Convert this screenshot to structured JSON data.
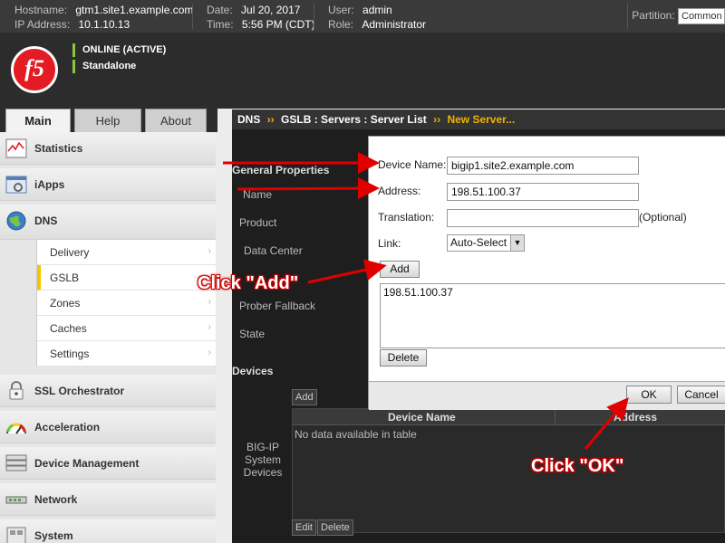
{
  "topbar": {
    "hostname_label": "Hostname:",
    "hostname": "gtm1.site1.example.com",
    "ip_label": "IP Address:",
    "ip": "10.1.10.13",
    "date_label": "Date:",
    "date": "Jul 20, 2017",
    "time_label": "Time:",
    "time": "5:56 PM (CDT)",
    "user_label": "User:",
    "user": "admin",
    "role_label": "Role:",
    "role": "Administrator",
    "partition_label": "Partition:",
    "partition": "Common"
  },
  "header": {
    "logo_text": "f5",
    "status_online": "ONLINE (ACTIVE)",
    "status_mode": "Standalone"
  },
  "tabs": [
    {
      "label": "Main",
      "active": true
    },
    {
      "label": "Help",
      "active": false
    },
    {
      "label": "About",
      "active": false
    }
  ],
  "sidebar": {
    "items": [
      {
        "label": "Statistics",
        "icon": "statistics-icon"
      },
      {
        "label": "iApps",
        "icon": "iapps-icon"
      },
      {
        "label": "DNS",
        "icon": "globe-icon"
      },
      {
        "label": "SSL Orchestrator",
        "icon": "lock-icon"
      },
      {
        "label": "Acceleration",
        "icon": "speedometer-icon"
      },
      {
        "label": "Device Management",
        "icon": "server-icon"
      },
      {
        "label": "Network",
        "icon": "network-icon"
      },
      {
        "label": "System",
        "icon": "system-icon"
      }
    ],
    "dns_sub": [
      {
        "label": "Delivery",
        "chevron": "›"
      },
      {
        "label": "GSLB",
        "chevron": ""
      },
      {
        "label": "Zones",
        "chevron": "›"
      },
      {
        "label": "Caches",
        "chevron": "›"
      },
      {
        "label": "Settings",
        "chevron": "›"
      }
    ]
  },
  "breadcrumb": {
    "parts": [
      "DNS",
      "GSLB : Servers : Server List"
    ],
    "current": "New Server...",
    "sep": "››"
  },
  "background_form": {
    "general_properties": "General Properties",
    "rows": [
      "Name",
      "Product",
      "Data Center",
      "Prober Fallback",
      "State"
    ],
    "devices_heading": "Devices",
    "bigip_label": "BIG-IP System Devices",
    "add_label": "Add",
    "col_device_name": "Device Name",
    "col_address": "Address",
    "no_data": "No data available in table",
    "edit_label": "Edit",
    "delete_label": "Delete"
  },
  "dialog": {
    "device_name_label": "Device Name:",
    "device_name": "bigip1.site2.example.com",
    "address_label": "Address:",
    "address": "198.51.100.37",
    "translation_label": "Translation:",
    "translation": "",
    "optional": "(Optional)",
    "link_label": "Link:",
    "link_value": "Auto-Select",
    "add_button": "Add",
    "address_list": [
      "198.51.100.37"
    ],
    "delete_button": "Delete",
    "ok_button": "OK",
    "cancel_button": "Cancel"
  },
  "annotations": {
    "click_add": "Click \"Add\"",
    "click_ok": "Click \"OK\""
  },
  "colors": {
    "accent_yellow": "#f0b400",
    "status_green": "#8cc63f",
    "annotation_red": "#e00000"
  }
}
